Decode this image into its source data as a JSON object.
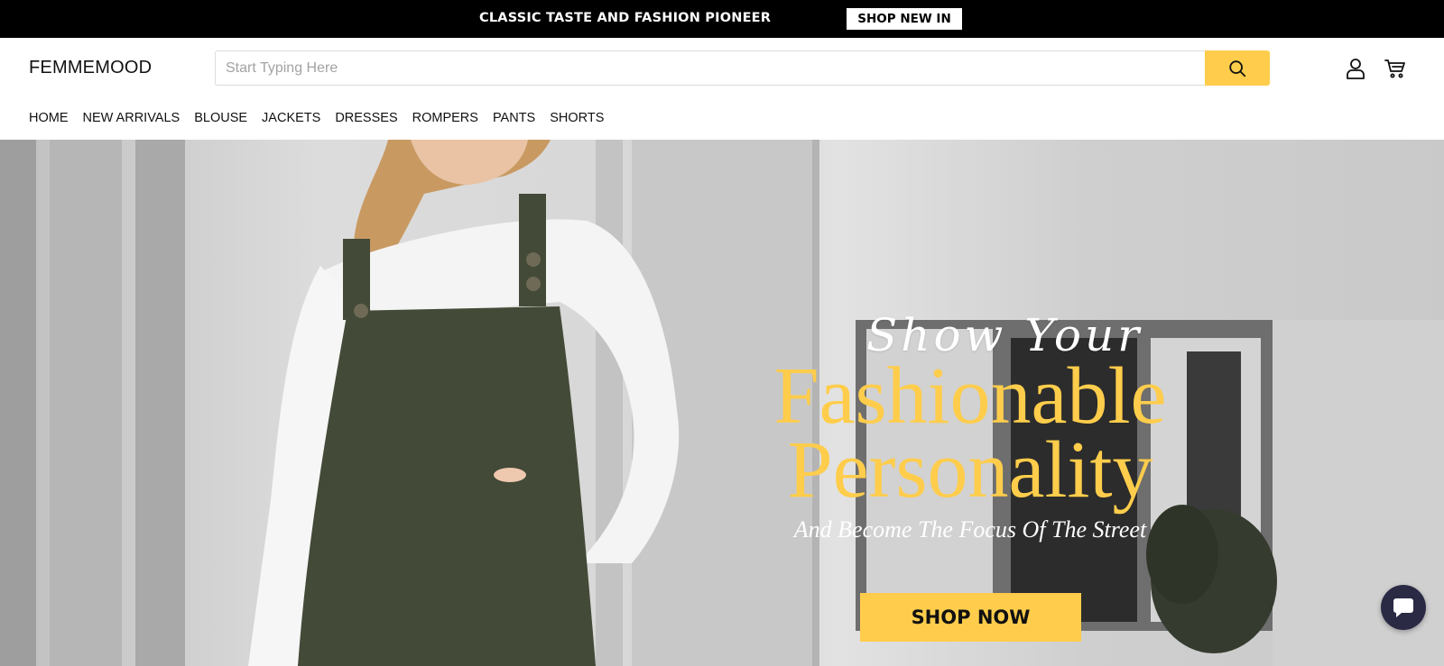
{
  "announcement": {
    "text": "CLASSIC TASTE AND FASHION PIONEER",
    "button_label": "SHOP NEW IN"
  },
  "header": {
    "logo": "FEMMEMOOD",
    "search": {
      "placeholder": "Start Typing Here",
      "value": ""
    },
    "icons": {
      "search": "search-icon",
      "account": "user-icon",
      "cart": "cart-icon"
    }
  },
  "nav": {
    "items": [
      "HOME",
      "NEW ARRIVALS",
      "BLOUSE",
      "JACKETS",
      "DRESSES",
      "ROMPERS",
      "PANTS",
      "SHORTS"
    ]
  },
  "hero": {
    "script_line": "Show Your",
    "title_line1": "Fashionable",
    "title_line2": "Personality",
    "subtitle": "And Become The Focus Of The Street",
    "cta_label": "SHOP NOW"
  },
  "chat": {
    "icon": "chat-bubble-icon"
  },
  "colors": {
    "accent": "#ffcd4b",
    "announcement_bg": "#000000",
    "chat_bg": "#2b2a45"
  }
}
